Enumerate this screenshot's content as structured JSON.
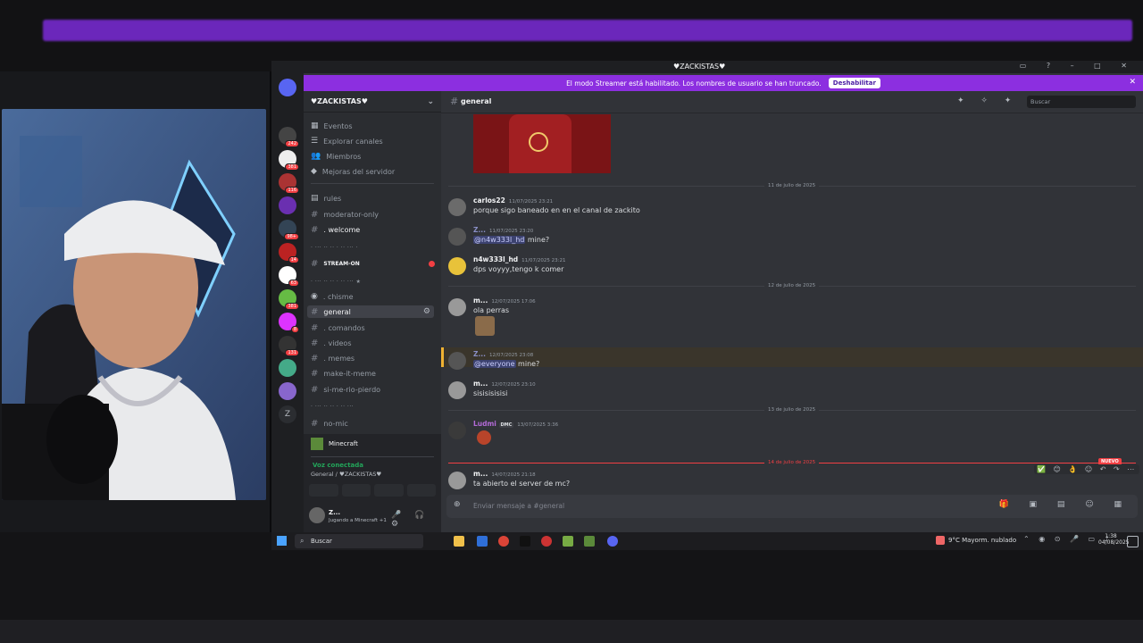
{
  "window_title": "♥ZACKISTAS♥",
  "streamer_banner": {
    "text": "El modo Streamer está habilitado. Los nombres de usuario se han truncado.",
    "button": "Deshabilitar"
  },
  "server": {
    "name": "♥ZACKISTAS♥",
    "menu": [
      "Eventos",
      "Explorar canales",
      "Miembros",
      "Mejoras del servidor"
    ],
    "channels_top": [
      "rules",
      "moderator-only",
      ". welcome"
    ],
    "category_stream": "STREAM-ON",
    "channels_mid": [
      ". chisme",
      "general",
      ". comandos",
      ". videos",
      ". memes",
      "make-it-meme",
      "si-me-rio-pierdo"
    ],
    "channels_bottom": [
      "no-mic"
    ]
  },
  "guild_badges": [
    "242",
    "381",
    "116",
    "98+",
    "14",
    "63",
    "381",
    "8",
    "131"
  ],
  "activity": {
    "game": "Minecraft"
  },
  "voice": {
    "status": "Voz conectada",
    "location": "General / ♥ZACKISTAS♥"
  },
  "user_panel": {
    "name": "Z...",
    "status": "Jugando a Minecraft +1"
  },
  "channel_header": {
    "name": "general",
    "search_placeholder": "Buscar"
  },
  "dates": [
    "11 de julio de 2025",
    "12 de julio de 2025",
    "13 de julio de 2025",
    "14 de julio de 2025"
  ],
  "messages": [
    {
      "user": "carlos22",
      "time": "11/07/2025 23:21",
      "text": "porque sigo baneado en en el canal de zackito"
    },
    {
      "user": "Z...",
      "time": "11/07/2025 23:20",
      "mention": "@n4w333l_hd",
      "text": "mine?"
    },
    {
      "user": "n4w333l_hd",
      "time": "11/07/2025 23:21",
      "text": "dps voyyy,tengo k comer"
    },
    {
      "user": "m...",
      "time": "12/07/2025 17:06",
      "text": "ola perras"
    },
    {
      "user": "Z...",
      "time": "12/07/2025 23:08",
      "mention": "@everyone",
      "text": "mine?"
    },
    {
      "user": "m...",
      "time": "12/07/2025 23:10",
      "text": "sisisisisisi"
    },
    {
      "user": "Ludmi",
      "role": "DMC",
      "time": "13/07/2025 3:36",
      "text": ""
    },
    {
      "user": "m...",
      "time": "14/07/2025 21:18",
      "text": "ta abierto el server de mc?"
    }
  ],
  "new_badge": "NUEVO",
  "composer_placeholder": "Enviar mensaje a #general",
  "taskbar": {
    "search": "Buscar",
    "weather": "9°C  Mayorm. nublado",
    "time": "1:38",
    "date": "04/08/2025"
  },
  "colors": {
    "accent": "#8c2fe0",
    "mention_bg": "#3c4270",
    "new_red": "#f23f43",
    "voice_green": "#23a55a"
  }
}
